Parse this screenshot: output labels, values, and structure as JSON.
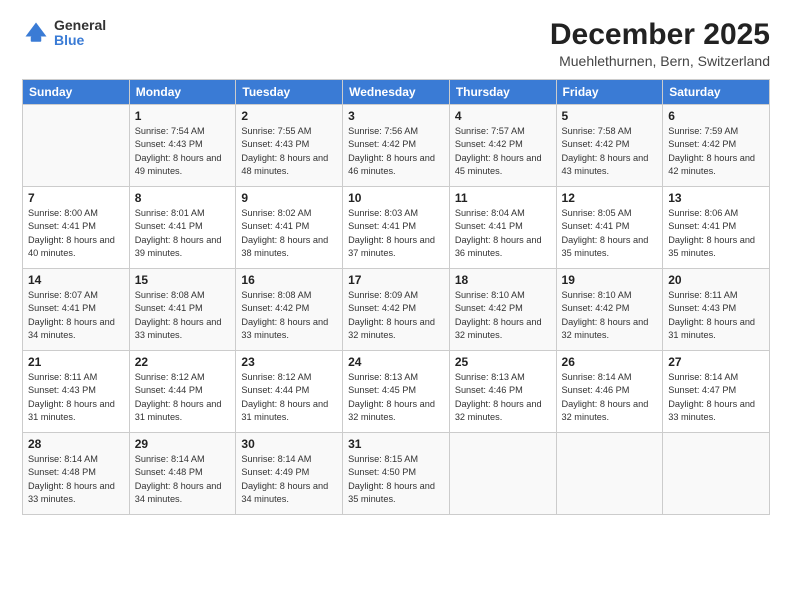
{
  "logo": {
    "general": "General",
    "blue": "Blue"
  },
  "title": "December 2025",
  "subtitle": "Muehlethurnen, Bern, Switzerland",
  "days_header": [
    "Sunday",
    "Monday",
    "Tuesday",
    "Wednesday",
    "Thursday",
    "Friday",
    "Saturday"
  ],
  "weeks": [
    [
      {
        "num": "",
        "sunrise": "",
        "sunset": "",
        "daylight": ""
      },
      {
        "num": "1",
        "sunrise": "Sunrise: 7:54 AM",
        "sunset": "Sunset: 4:43 PM",
        "daylight": "Daylight: 8 hours and 49 minutes."
      },
      {
        "num": "2",
        "sunrise": "Sunrise: 7:55 AM",
        "sunset": "Sunset: 4:43 PM",
        "daylight": "Daylight: 8 hours and 48 minutes."
      },
      {
        "num": "3",
        "sunrise": "Sunrise: 7:56 AM",
        "sunset": "Sunset: 4:42 PM",
        "daylight": "Daylight: 8 hours and 46 minutes."
      },
      {
        "num": "4",
        "sunrise": "Sunrise: 7:57 AM",
        "sunset": "Sunset: 4:42 PM",
        "daylight": "Daylight: 8 hours and 45 minutes."
      },
      {
        "num": "5",
        "sunrise": "Sunrise: 7:58 AM",
        "sunset": "Sunset: 4:42 PM",
        "daylight": "Daylight: 8 hours and 43 minutes."
      },
      {
        "num": "6",
        "sunrise": "Sunrise: 7:59 AM",
        "sunset": "Sunset: 4:42 PM",
        "daylight": "Daylight: 8 hours and 42 minutes."
      }
    ],
    [
      {
        "num": "7",
        "sunrise": "Sunrise: 8:00 AM",
        "sunset": "Sunset: 4:41 PM",
        "daylight": "Daylight: 8 hours and 40 minutes."
      },
      {
        "num": "8",
        "sunrise": "Sunrise: 8:01 AM",
        "sunset": "Sunset: 4:41 PM",
        "daylight": "Daylight: 8 hours and 39 minutes."
      },
      {
        "num": "9",
        "sunrise": "Sunrise: 8:02 AM",
        "sunset": "Sunset: 4:41 PM",
        "daylight": "Daylight: 8 hours and 38 minutes."
      },
      {
        "num": "10",
        "sunrise": "Sunrise: 8:03 AM",
        "sunset": "Sunset: 4:41 PM",
        "daylight": "Daylight: 8 hours and 37 minutes."
      },
      {
        "num": "11",
        "sunrise": "Sunrise: 8:04 AM",
        "sunset": "Sunset: 4:41 PM",
        "daylight": "Daylight: 8 hours and 36 minutes."
      },
      {
        "num": "12",
        "sunrise": "Sunrise: 8:05 AM",
        "sunset": "Sunset: 4:41 PM",
        "daylight": "Daylight: 8 hours and 35 minutes."
      },
      {
        "num": "13",
        "sunrise": "Sunrise: 8:06 AM",
        "sunset": "Sunset: 4:41 PM",
        "daylight": "Daylight: 8 hours and 35 minutes."
      }
    ],
    [
      {
        "num": "14",
        "sunrise": "Sunrise: 8:07 AM",
        "sunset": "Sunset: 4:41 PM",
        "daylight": "Daylight: 8 hours and 34 minutes."
      },
      {
        "num": "15",
        "sunrise": "Sunrise: 8:08 AM",
        "sunset": "Sunset: 4:41 PM",
        "daylight": "Daylight: 8 hours and 33 minutes."
      },
      {
        "num": "16",
        "sunrise": "Sunrise: 8:08 AM",
        "sunset": "Sunset: 4:42 PM",
        "daylight": "Daylight: 8 hours and 33 minutes."
      },
      {
        "num": "17",
        "sunrise": "Sunrise: 8:09 AM",
        "sunset": "Sunset: 4:42 PM",
        "daylight": "Daylight: 8 hours and 32 minutes."
      },
      {
        "num": "18",
        "sunrise": "Sunrise: 8:10 AM",
        "sunset": "Sunset: 4:42 PM",
        "daylight": "Daylight: 8 hours and 32 minutes."
      },
      {
        "num": "19",
        "sunrise": "Sunrise: 8:10 AM",
        "sunset": "Sunset: 4:42 PM",
        "daylight": "Daylight: 8 hours and 32 minutes."
      },
      {
        "num": "20",
        "sunrise": "Sunrise: 8:11 AM",
        "sunset": "Sunset: 4:43 PM",
        "daylight": "Daylight: 8 hours and 31 minutes."
      }
    ],
    [
      {
        "num": "21",
        "sunrise": "Sunrise: 8:11 AM",
        "sunset": "Sunset: 4:43 PM",
        "daylight": "Daylight: 8 hours and 31 minutes."
      },
      {
        "num": "22",
        "sunrise": "Sunrise: 8:12 AM",
        "sunset": "Sunset: 4:44 PM",
        "daylight": "Daylight: 8 hours and 31 minutes."
      },
      {
        "num": "23",
        "sunrise": "Sunrise: 8:12 AM",
        "sunset": "Sunset: 4:44 PM",
        "daylight": "Daylight: 8 hours and 31 minutes."
      },
      {
        "num": "24",
        "sunrise": "Sunrise: 8:13 AM",
        "sunset": "Sunset: 4:45 PM",
        "daylight": "Daylight: 8 hours and 32 minutes."
      },
      {
        "num": "25",
        "sunrise": "Sunrise: 8:13 AM",
        "sunset": "Sunset: 4:46 PM",
        "daylight": "Daylight: 8 hours and 32 minutes."
      },
      {
        "num": "26",
        "sunrise": "Sunrise: 8:14 AM",
        "sunset": "Sunset: 4:46 PM",
        "daylight": "Daylight: 8 hours and 32 minutes."
      },
      {
        "num": "27",
        "sunrise": "Sunrise: 8:14 AM",
        "sunset": "Sunset: 4:47 PM",
        "daylight": "Daylight: 8 hours and 33 minutes."
      }
    ],
    [
      {
        "num": "28",
        "sunrise": "Sunrise: 8:14 AM",
        "sunset": "Sunset: 4:48 PM",
        "daylight": "Daylight: 8 hours and 33 minutes."
      },
      {
        "num": "29",
        "sunrise": "Sunrise: 8:14 AM",
        "sunset": "Sunset: 4:48 PM",
        "daylight": "Daylight: 8 hours and 34 minutes."
      },
      {
        "num": "30",
        "sunrise": "Sunrise: 8:14 AM",
        "sunset": "Sunset: 4:49 PM",
        "daylight": "Daylight: 8 hours and 34 minutes."
      },
      {
        "num": "31",
        "sunrise": "Sunrise: 8:15 AM",
        "sunset": "Sunset: 4:50 PM",
        "daylight": "Daylight: 8 hours and 35 minutes."
      },
      {
        "num": "",
        "sunrise": "",
        "sunset": "",
        "daylight": ""
      },
      {
        "num": "",
        "sunrise": "",
        "sunset": "",
        "daylight": ""
      },
      {
        "num": "",
        "sunrise": "",
        "sunset": "",
        "daylight": ""
      }
    ]
  ]
}
